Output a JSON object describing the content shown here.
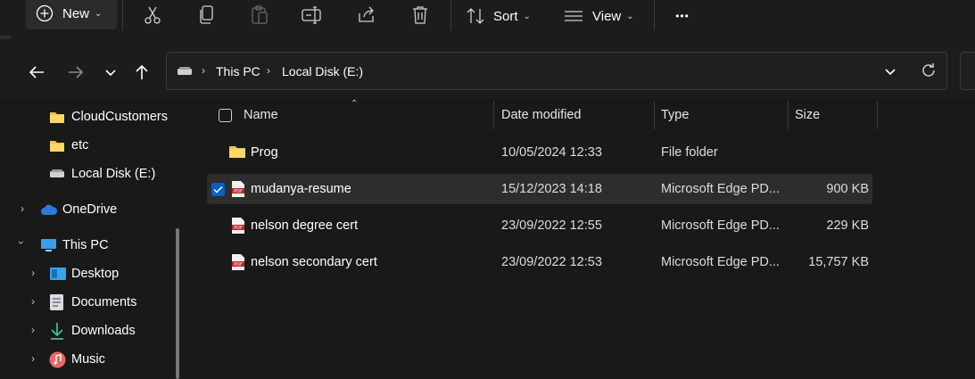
{
  "toolbar": {
    "new_label": "New",
    "sort_label": "Sort",
    "view_label": "View",
    "more_label": "•••"
  },
  "address": {
    "crumbs": [
      "This PC",
      "Local Disk (E:)"
    ]
  },
  "sidebar": {
    "items": [
      {
        "label": "CloudCustomers",
        "icon": "folder-icon"
      },
      {
        "label": "etc",
        "icon": "folder-icon"
      },
      {
        "label": "Local Disk (E:)",
        "icon": "drive-icon"
      },
      {
        "label": "OneDrive",
        "icon": "cloud-icon"
      },
      {
        "label": "This PC",
        "icon": "monitor-icon"
      },
      {
        "label": "Desktop",
        "icon": "desktop-icon"
      },
      {
        "label": "Documents",
        "icon": "documents-icon"
      },
      {
        "label": "Downloads",
        "icon": "download-icon"
      },
      {
        "label": "Music",
        "icon": "music-icon"
      }
    ]
  },
  "columns": {
    "name": "Name",
    "date": "Date modified",
    "type": "Type",
    "size": "Size"
  },
  "files": [
    {
      "name": "Prog",
      "date": "10/05/2024 12:33",
      "type": "File folder",
      "size": "",
      "icon": "folder-icon",
      "selected": false
    },
    {
      "name": "mudanya-resume",
      "date": "15/12/2023 14:18",
      "type": "Microsoft Edge PD...",
      "size": "900 KB",
      "icon": "pdf-icon",
      "selected": true
    },
    {
      "name": "nelson degree cert",
      "date": "23/09/2022 12:55",
      "type": "Microsoft Edge PD...",
      "size": "229 KB",
      "icon": "pdf-icon",
      "selected": false
    },
    {
      "name": "nelson secondary cert",
      "date": "23/09/2022 12:53",
      "type": "Microsoft Edge PD...",
      "size": "15,757 KB",
      "icon": "pdf-icon",
      "selected": false
    }
  ],
  "colors": {
    "accent": "#0a5fc4",
    "folder": "#f4c04d",
    "pdf_red": "#c4262e"
  }
}
